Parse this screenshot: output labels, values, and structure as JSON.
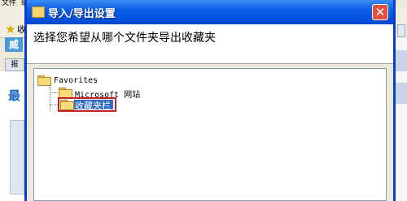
{
  "background": {
    "menu_file": "文件",
    "menu_edit": "编",
    "favorites_label": "收",
    "logo_char": "威",
    "tab_label": "报",
    "blue_text": "最"
  },
  "dialog": {
    "title": "导入/导出设置",
    "close_label": "✕",
    "instruction": "选择您希望从哪个文件夹导出收藏夹",
    "tree": {
      "root": "Favorites",
      "children": [
        {
          "label": "Microsoft 网站"
        },
        {
          "label": "收藏夹栏"
        }
      ]
    }
  },
  "colors": {
    "titlebar": "#0a5fe8",
    "selection": "#316ac5",
    "highlight_border": "#cc1f1f"
  }
}
